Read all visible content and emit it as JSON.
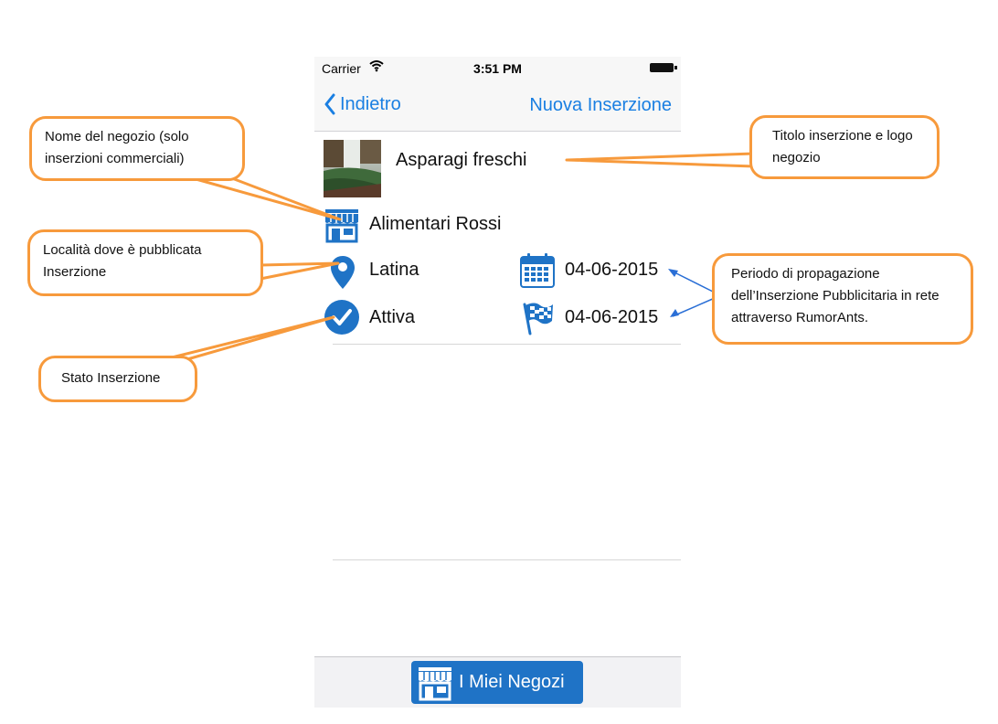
{
  "status_bar": {
    "carrier": "Carrier",
    "time": "3:51 PM"
  },
  "nav": {
    "back_label": "Indietro",
    "right_label": "Nuova Inserzione"
  },
  "ad": {
    "title": "Asparagi freschi",
    "shop_name": "Alimentari Rossi",
    "location": "Latina",
    "status": "Attiva",
    "start_date": "04-06-2015",
    "end_date": "04-06-2015"
  },
  "tab_bar": {
    "button_label": "I Miei Negozi"
  },
  "callouts": {
    "shop_name": "Nome del negozio (solo inserzioni commerciali)",
    "title_logo": "Titolo inserzione e logo negozio",
    "location": "Località dove è pubblicata Inserzione",
    "period": "Periodo di propagazione dell’Inserzione Pubblicitaria in rete attraverso RumorAnts.",
    "status": "Stato Inserzione"
  },
  "colors": {
    "ios_blue": "#1a7fe2",
    "icon_blue": "#1f73c6",
    "callout_orange": "#f79a3c",
    "arrow_blue": "#2a6fd6"
  },
  "icons": [
    "wifi-icon",
    "battery-icon",
    "back-chevron-icon",
    "store-icon",
    "location-pin-icon",
    "calendar-icon",
    "checkered-flag-icon",
    "checkmark-circle-icon"
  ]
}
